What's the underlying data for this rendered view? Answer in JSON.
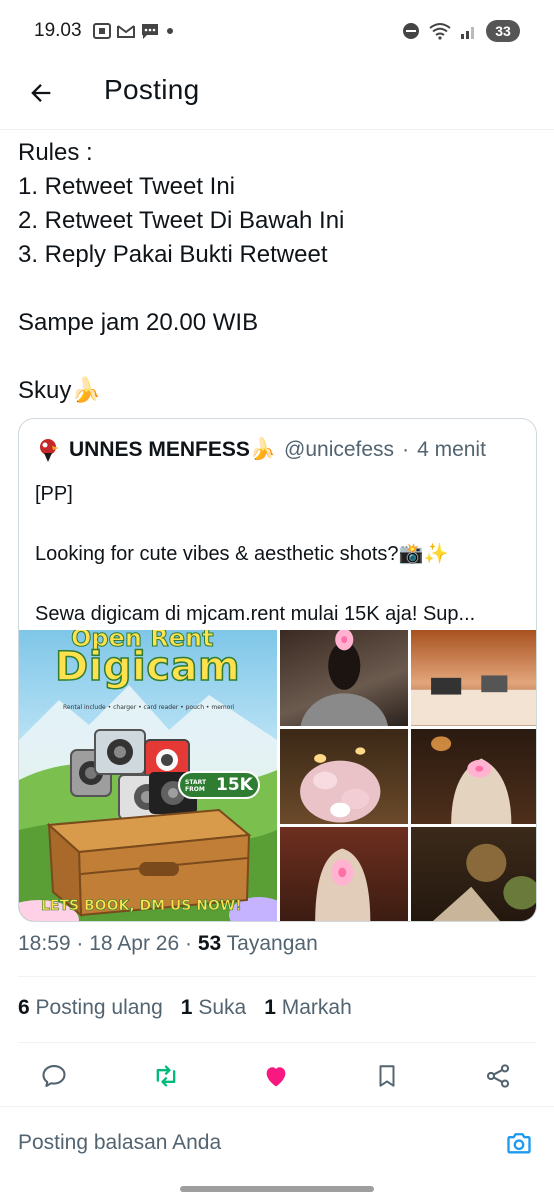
{
  "status_bar": {
    "time": "19.03",
    "battery": "33"
  },
  "header": {
    "title": "Posting"
  },
  "post": {
    "text": "Rules :\n1. Retweet Tweet Ini\n2. Retweet Tweet Di Bawah Ini\n3. Reply Pakai Bukti Retweet\n\nSampe jam 20.00 WIB\n\nSkuy🍌"
  },
  "quote": {
    "author_name": "UNNES MENFESS🍌",
    "handle": "@unicefess",
    "separator": "·",
    "time": "4 menit",
    "body": "[PP]\n\nLooking for cute vibes & aesthetic shots?📸✨\n\nSewa digicam di mjcam.rent mulai 15K aja! Sup...",
    "poster": {
      "line1": "Open Rent",
      "line2": "Digicam",
      "include": "Rental include • charger • card reader • pouch • memori",
      "start_from": "START FROM",
      "price": "15K",
      "cta": "LETS BOOK, DM US NOW!"
    }
  },
  "meta": {
    "time": "18:59",
    "date": "18 Apr 26",
    "views": "53",
    "views_label": "Tayangan",
    "sep": "·"
  },
  "stats": {
    "reposts": "6",
    "reposts_label": "Posting ulang",
    "likes": "1",
    "likes_label": "Suka",
    "bookmarks": "1",
    "bookmarks_label": "Markah"
  },
  "reply": {
    "placeholder": "Posting balasan Anda"
  },
  "colors": {
    "like": "#f91880",
    "repost": "#00ba7c",
    "link": "#1d9bf0",
    "muted": "#536471"
  }
}
